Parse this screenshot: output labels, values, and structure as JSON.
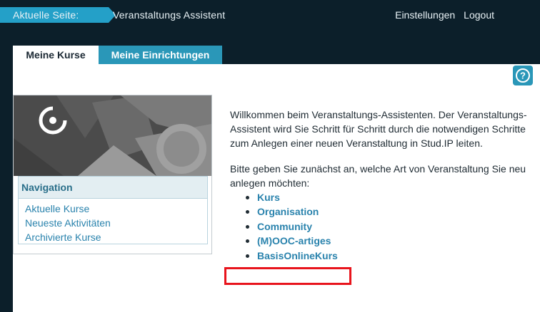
{
  "topbar": {
    "current_label": "Aktuelle Seite:",
    "page_title": "Veranstaltungs Assistent",
    "settings_label": "Einstellungen",
    "logout_label": "Logout"
  },
  "tabs": [
    {
      "label": "Meine Kurse",
      "active": true
    },
    {
      "label": "Meine Einrichtungen",
      "active": false
    }
  ],
  "help_icon": "question-circle-icon",
  "sidebar": {
    "nav_title": "Navigation",
    "links": [
      "Aktuelle Kurse",
      "Neueste Aktivitäten",
      "Archivierte Kurse"
    ]
  },
  "main": {
    "intro": "Willkommen beim Veranstaltungs-Assistenten. Der Veranstaltungs-Assistent wird Sie Schritt für Schritt durch die notwendigen Schritte zum Anlegen einer neuen Veranstaltung in Stud.IP leiten.",
    "question": "Bitte geben Sie zunächst an, welche Art von Veranstaltung Sie neu anlegen möchten:",
    "options": [
      "Kurs",
      "Organisation",
      "Community",
      "(M)OOC-artiges",
      "BasisOnlineKurs"
    ]
  },
  "colors": {
    "accent": "#2a97b8",
    "link": "#2a83ad",
    "dark_bg": "#0c1f2a",
    "highlight": "#e8141c"
  }
}
